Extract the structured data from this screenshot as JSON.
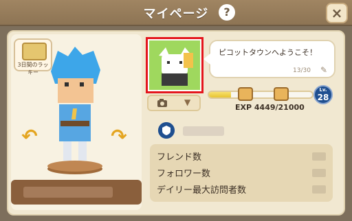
{
  "header": {
    "title": "マイページ",
    "help_icon": "?",
    "close_icon": "×"
  },
  "login_bonus": {
    "label": "3日間のラッキー"
  },
  "profile": {
    "message": "ピコットタウンへようこそ！",
    "message_count": "13/30",
    "exp": {
      "text": "EXP 4449/21000",
      "current": 4449,
      "max": 21000
    },
    "level": {
      "label": "Lv.",
      "value": "28"
    }
  },
  "stats": {
    "rows": [
      {
        "label": "フレンド数"
      },
      {
        "label": "フォロワー数"
      },
      {
        "label": "デイリー最大訪問者数"
      }
    ]
  },
  "icons": {
    "help": "help-icon",
    "close": "close-icon",
    "camera": "camera-icon",
    "chevron": "chevron-down-icon",
    "edit": "edit-icon",
    "rotate_left": "rotate-left-icon",
    "rotate_right": "rotate-right-icon",
    "shield": "shield-icon",
    "chest": "treasure-chest-icon"
  },
  "colors": {
    "accent_red": "#e4161d",
    "level_blue": "#1f4f90",
    "exp_gold": "#e6c433"
  }
}
